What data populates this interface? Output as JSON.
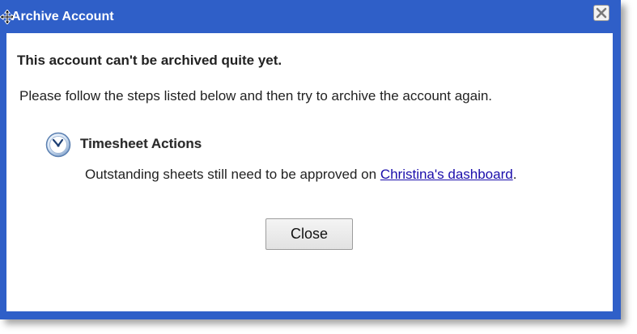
{
  "window": {
    "title": "Archive Account",
    "close_icon": "close-icon",
    "move_icon": "move-cursor-icon"
  },
  "content": {
    "headline": "This account can't be archived quite yet.",
    "instructions": "Please follow the steps listed below and then try to archive the account again.",
    "section": {
      "icon": "clock-icon",
      "title": "Timesheet Actions",
      "message_prefix": "Outstanding sheets still need to be approved on ",
      "link_text": "Christina's dashboard",
      "message_suffix": "."
    },
    "close_button_label": "Close"
  },
  "colors": {
    "frame": "#2f5fc8",
    "link": "#1a0dab"
  }
}
